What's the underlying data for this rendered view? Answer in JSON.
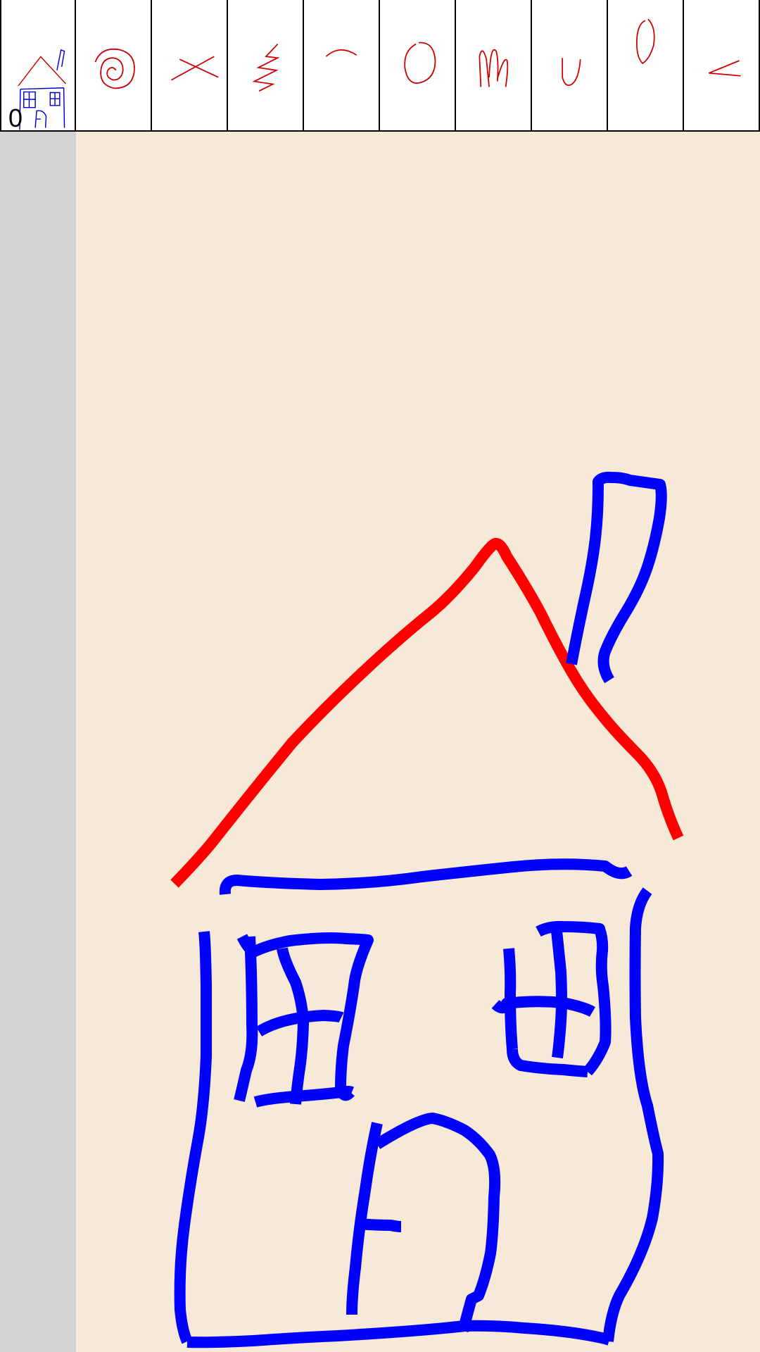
{
  "thumbnails": [
    {
      "name": "house",
      "index_label": "0",
      "selected": true
    },
    {
      "name": "spiral"
    },
    {
      "name": "x-mark"
    },
    {
      "name": "zigzag"
    },
    {
      "name": "arc"
    },
    {
      "name": "circle"
    },
    {
      "name": "m-scribble"
    },
    {
      "name": "u-shape"
    },
    {
      "name": "zero-shape"
    },
    {
      "name": "less-than"
    }
  ],
  "colors": {
    "canvas_background": "#f6e9d8",
    "side_panel": "#d3d3d3",
    "stroke_red": "#ff0000",
    "stroke_blue": "#0000ff",
    "thumb_red": "#cc0000",
    "thumb_blue": "#0000cc"
  }
}
